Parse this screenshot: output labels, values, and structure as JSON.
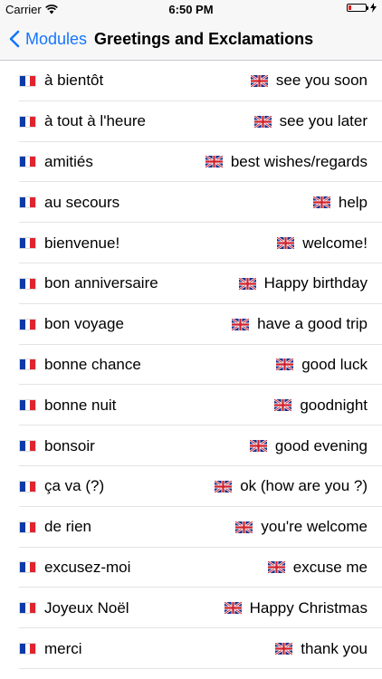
{
  "status_bar": {
    "carrier": "Carrier",
    "time": "6:50 PM",
    "battery_level": 0.15
  },
  "nav": {
    "back_label": "Modules",
    "title": "Greetings and Exclamations"
  },
  "colors": {
    "accent": "#1476fb",
    "battery_low": "#e02020"
  },
  "rows": [
    {
      "fr": "à bientôt",
      "en": "see you soon"
    },
    {
      "fr": "à tout à l'heure",
      "en": "see you later"
    },
    {
      "fr": "amitiés",
      "en": "best wishes/regards"
    },
    {
      "fr": "au secours",
      "en": "help"
    },
    {
      "fr": "bienvenue!",
      "en": "welcome!"
    },
    {
      "fr": "bon anniversaire",
      "en": "Happy birthday"
    },
    {
      "fr": "bon voyage",
      "en": "have a good trip"
    },
    {
      "fr": "bonne chance",
      "en": "good luck"
    },
    {
      "fr": "bonne nuit",
      "en": "goodnight"
    },
    {
      "fr": "bonsoir",
      "en": "good evening"
    },
    {
      "fr": "ça va (?)",
      "en": "ok (how are you ?)"
    },
    {
      "fr": "de rien",
      "en": "you're welcome"
    },
    {
      "fr": "excusez-moi",
      "en": "excuse me"
    },
    {
      "fr": "Joyeux Noël",
      "en": "Happy Christmas"
    },
    {
      "fr": "merci",
      "en": "thank you"
    }
  ]
}
